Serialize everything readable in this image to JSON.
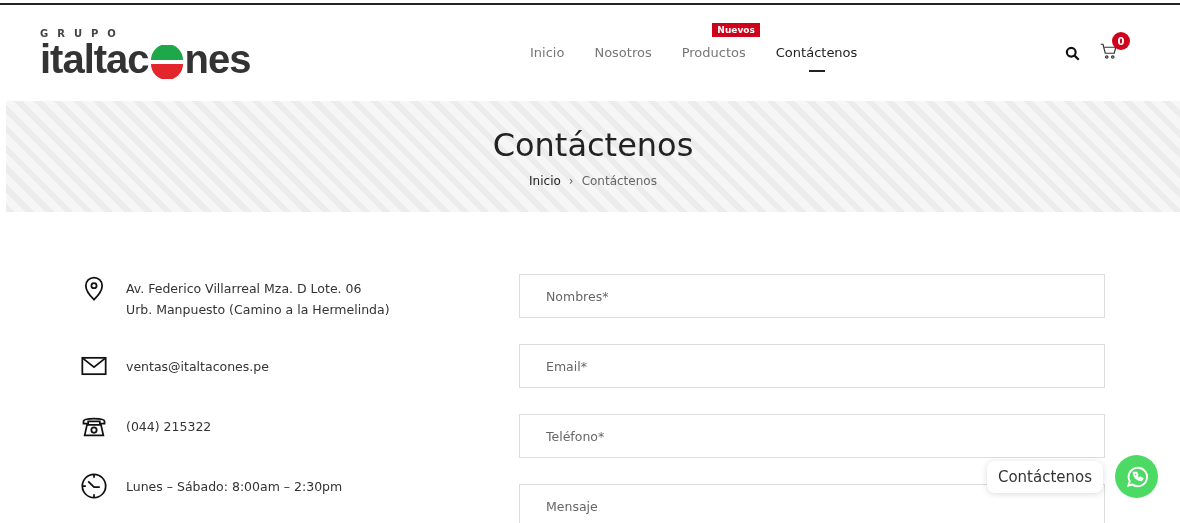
{
  "logo": {
    "top": "GRUPO",
    "left": "italtac",
    "right": "nes"
  },
  "nav": [
    {
      "label": "Inicio",
      "selected": false
    },
    {
      "label": "Nosotros",
      "selected": false
    },
    {
      "label": "Productos",
      "selected": false,
      "badge": "Nuevos"
    },
    {
      "label": "Contáctenos",
      "selected": true
    }
  ],
  "cart": {
    "count": "0"
  },
  "banner": {
    "title": "Contáctenos",
    "breadcrumb": [
      {
        "label": "Inicio",
        "kind": "link"
      },
      {
        "label": "›",
        "kind": "separator"
      },
      {
        "label": "Contáctenos",
        "kind": "current"
      }
    ]
  },
  "contact_info": [
    {
      "kind": "location",
      "lines": [
        "Av. Federico Villarreal Mza. D Lote. 06",
        "Urb. Manpuesto (Camino a la Hermelinda)"
      ]
    },
    {
      "kind": "email",
      "lines": [
        "ventas@italtacones.pe"
      ]
    },
    {
      "kind": "phone",
      "lines": [
        "(044) 215322"
      ]
    },
    {
      "kind": "hours",
      "lines": [
        "Lunes – Sábado: 8:00am – 2:30pm"
      ]
    }
  ],
  "form": [
    {
      "placeholder": "Nombres*",
      "kind": "input"
    },
    {
      "placeholder": "Email*",
      "kind": "input"
    },
    {
      "placeholder": "Teléfono*",
      "kind": "input"
    },
    {
      "placeholder": "Mensaje",
      "kind": "textarea"
    }
  ],
  "chat": {
    "label": "Contáctenos"
  }
}
